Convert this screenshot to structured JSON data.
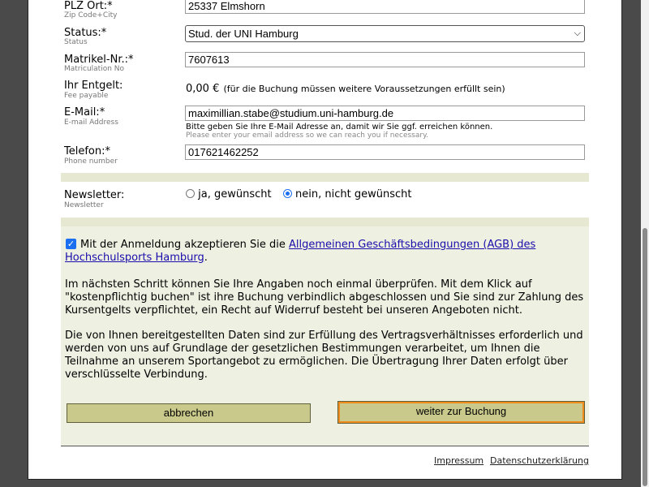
{
  "form": {
    "zip": {
      "label": "PLZ Ort:*",
      "sub": "Zip Code+City",
      "value": "25337 Elmshorn"
    },
    "status": {
      "label": "Status:*",
      "sub": "Status",
      "value": "Stud. der UNI Hamburg"
    },
    "matrikel": {
      "label": "Matrikel-Nr.:*",
      "sub": "Matriculation No",
      "value": "7607613"
    },
    "fee": {
      "label": "Ihr Entgelt:",
      "sub": "Fee payable",
      "amount": "0,00 €",
      "note": "(für die Buchung müssen weitere Voraussetzungen erfüllt sein)"
    },
    "email": {
      "label": "E-Mail:*",
      "sub": "E-mail Address",
      "value": "maximillian.stabe@studium.uni-hamburg.de",
      "hint": "Bitte geben Sie Ihre E-Mail Adresse an, damit wir Sie ggf. erreichen können.",
      "hint_en": "Please enter your email address so we can reach you if necessary."
    },
    "phone": {
      "label": "Telefon:*",
      "sub": "Phone number",
      "value": "017621462252"
    },
    "newsletter": {
      "label": "Newsletter:",
      "sub": "Newsletter",
      "opt_yes": "ja, gewünscht",
      "opt_no": "nein, nicht gewünscht",
      "selected": "nein, nicht gewünscht"
    }
  },
  "agb": {
    "checked": true,
    "text_before": "Mit der Anmeldung akzeptieren Sie die ",
    "link": "Allgemeinen Geschäftsbedingungen (AGB) des Hochschulsports Hamburg",
    "text_after": "."
  },
  "info": {
    "para1": "Im nächsten Schritt können Sie Ihre Angaben noch einmal überprüfen. Mit dem Klick auf \"kostenpflichtig buchen\" ist ihre Buchung verbindlich abgeschlossen und Sie sind zur Zahlung des Kursentgelts verpflichtet, ein Recht auf Widerruf besteht bei unseren Angeboten nicht.",
    "para2": "Die von Ihnen bereitgestellten Daten sind zur Erfüllung des Vertragsverhältnisses erforderlich und werden von uns auf Grundlage der gesetzlichen Bestimmungen verarbeitet, um Ihnen die Teilnahme an unserem Sportangebot zu ermöglichen. Die Übertragung Ihrer Daten erfolgt über verschlüsselte Verbindung."
  },
  "buttons": {
    "cancel": "abbrechen",
    "next": "weiter zur Buchung"
  },
  "footer": {
    "impressum": "Impressum",
    "privacy": "Datenschutzerklärung"
  },
  "colors": {
    "panel": "#eef0e2",
    "band": "#e7e8d1",
    "button": "#c9c98c",
    "focus": "#f08c1b",
    "link": "#1a0dab"
  }
}
